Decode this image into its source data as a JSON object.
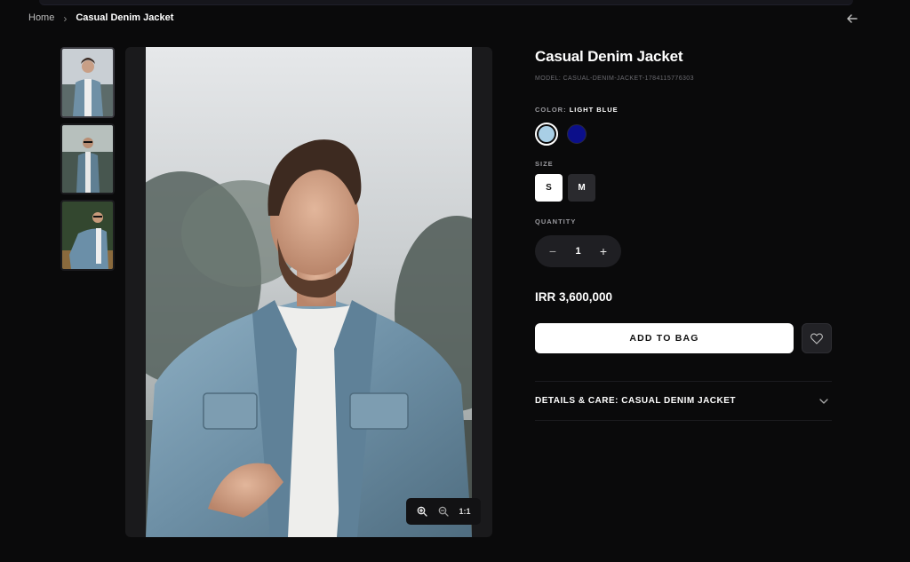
{
  "breadcrumb": {
    "home": "Home",
    "separator": "›",
    "current": "Casual Denim Jacket"
  },
  "gallery": {
    "thumbnails": [
      {
        "name": "thumb-1",
        "active": true
      },
      {
        "name": "thumb-2",
        "active": false
      },
      {
        "name": "thumb-3",
        "active": false
      }
    ],
    "zoom_reset_label": "1:1"
  },
  "product": {
    "title": "Casual Denim Jacket",
    "model": "MODEL: CASUAL-DENIM-JACKET-1784115776303",
    "color_label": "COLOR:",
    "color_value": "LIGHT BLUE",
    "colors": [
      {
        "name": "Light Blue",
        "hex": "#a9cfe6",
        "selected": true
      },
      {
        "name": "Navy",
        "hex": "#0b0f8a",
        "selected": false
      }
    ],
    "size_label": "SIZE",
    "sizes": [
      {
        "label": "S",
        "selected": true
      },
      {
        "label": "M",
        "selected": false
      }
    ],
    "quantity_label": "QUANTITY",
    "quantity": "1",
    "price": "IRR 3,600,000",
    "add_to_bag_label": "ADD TO BAG",
    "details_title": "DETAILS & CARE: CASUAL DENIM JACKET"
  },
  "icons": {
    "back": "arrow-left-icon",
    "zoom_in": "zoom-in-icon",
    "zoom_out": "zoom-out-icon",
    "wishlist": "heart-icon",
    "details_toggle": "chevron-down-icon"
  },
  "colors": {
    "background": "#0a0a0b",
    "button_primary": "#ffffff",
    "surface": "#1f1f23"
  }
}
